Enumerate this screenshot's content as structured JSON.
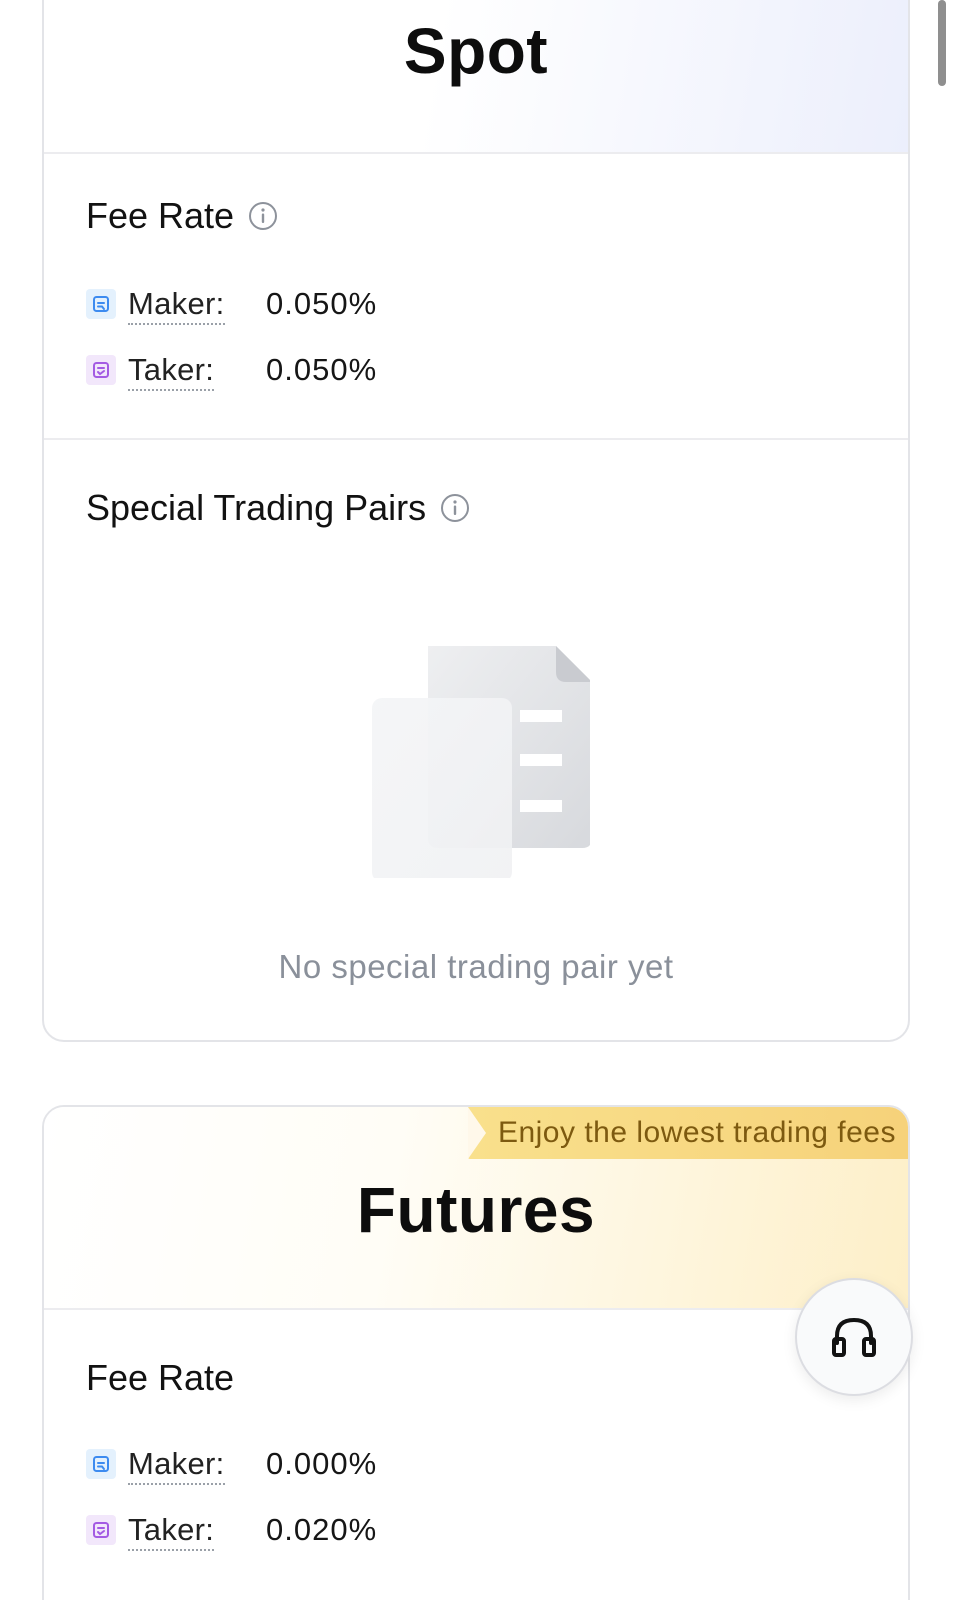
{
  "spot": {
    "title": "Spot",
    "fee_rate": {
      "heading": "Fee Rate",
      "maker_label": "Maker:",
      "maker_value": "0.050%",
      "taker_label": "Taker:",
      "taker_value": "0.050%"
    },
    "special_pairs": {
      "heading": "Special Trading Pairs",
      "empty_text": "No special trading pair yet"
    }
  },
  "futures": {
    "promo": "Enjoy the lowest trading fees",
    "title": "Futures",
    "fee_rate": {
      "heading": "Fee Rate",
      "maker_label": "Maker:",
      "maker_value": "0.000%",
      "taker_label": "Taker:",
      "taker_value": "0.020%"
    }
  },
  "icons": {
    "info": "info-icon",
    "maker": "maker-icon",
    "taker": "taker-icon",
    "support": "headset-icon",
    "empty": "empty-document-icon"
  },
  "colors": {
    "maker_icon": "#3d8bf0",
    "taker_icon": "#a45be3",
    "promo_bg": "#f7d881",
    "promo_text": "#7d5a10",
    "muted_text": "#8a909a"
  }
}
